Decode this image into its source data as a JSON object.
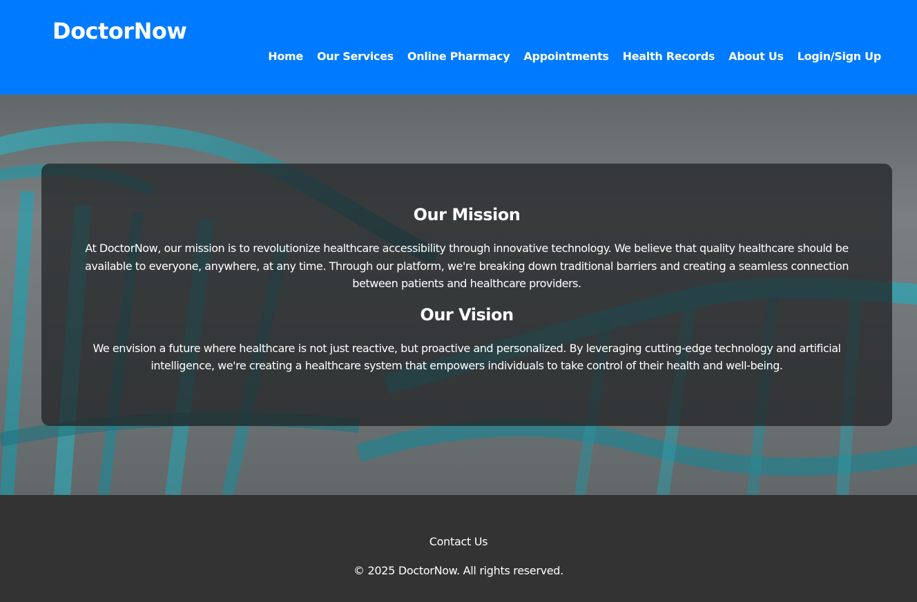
{
  "header": {
    "logo": "DoctorNow",
    "nav": [
      {
        "label": "Home"
      },
      {
        "label": "Our Services"
      },
      {
        "label": "Online Pharmacy"
      },
      {
        "label": "Appointments"
      },
      {
        "label": "Health Records"
      },
      {
        "label": "About Us"
      },
      {
        "label": "Login/Sign Up"
      }
    ]
  },
  "main": {
    "mission_title": "Our Mission",
    "mission_text": "At DoctorNow, our mission is to revolutionize healthcare accessibility through innovative technology. We believe that quality healthcare should be available to everyone, anywhere, at any time. Through our platform, we're breaking down traditional barriers and creating a seamless connection between patients and healthcare providers.",
    "vision_title": "Our Vision",
    "vision_text": "We envision a future where healthcare is not just reactive, but proactive and personalized. By leveraging cutting-edge technology and artificial intelligence, we're creating a healthcare system that empowers individuals to take control of their health and well-being."
  },
  "footer": {
    "contact": "Contact Us",
    "copyright": "© 2025 DoctorNow. All rights reserved."
  },
  "colors": {
    "brand": "#007bff",
    "footer_bg": "#333333",
    "dna_accent": "#2bb5c4"
  }
}
